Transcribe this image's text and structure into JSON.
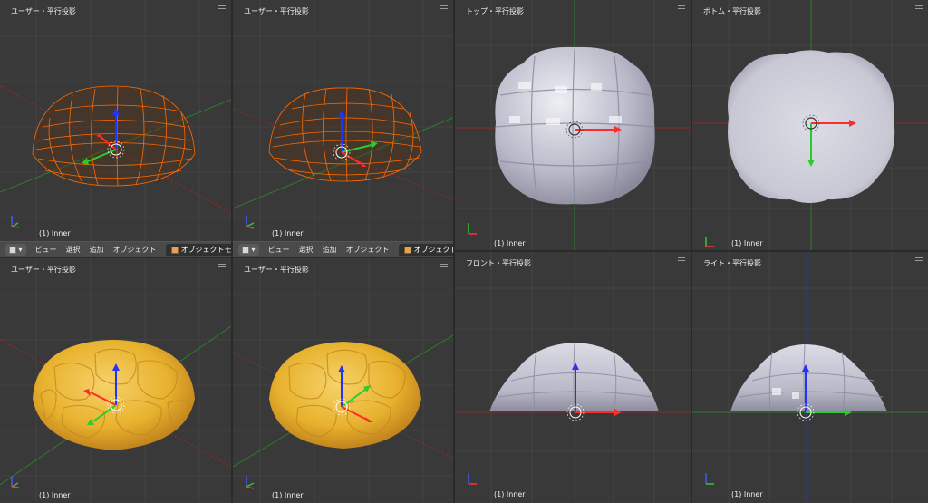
{
  "viewports": [
    {
      "title": "ユーザー・平行投影",
      "object": "(1) Inner",
      "style": "wireframe"
    },
    {
      "title": "ユーザー・平行投影",
      "object": "(1) Inner",
      "style": "wireframe"
    },
    {
      "title": "ユーザー・平行投影",
      "object": "(1) Inner",
      "style": "textured"
    },
    {
      "title": "ユーザー・平行投影",
      "object": "(1) Inner",
      "style": "textured"
    },
    {
      "title": "トップ・平行投影",
      "object": "(1) Inner",
      "style": "solid-top"
    },
    {
      "title": "ボトム・平行投影",
      "object": "(1) Inner",
      "style": "solid-bottom"
    },
    {
      "title": "フロント・平行投影",
      "object": "(1) Inner",
      "style": "solid-front"
    },
    {
      "title": "ライト・平行投影",
      "object": "(1) Inner",
      "style": "solid-side"
    }
  ],
  "header_bars": [
    {
      "view": "ビュー",
      "select": "選択",
      "add": "追加",
      "object": "オブジェクト",
      "mode": "オブジェクトモード"
    },
    {
      "view": "ビュー",
      "select": "選択",
      "add": "追加",
      "object": "オブジェクト",
      "mode": "オブジェクトモード"
    }
  ],
  "colors": {
    "viewport_bg": "#393939",
    "grid": "#444444",
    "x_axis": "#8c2a2a",
    "y_axis": "#2f7a2f",
    "z_axis": "#2a3a8c",
    "wire": "#ff6a00",
    "bread_light": "#f2c24a",
    "bread_dark": "#c98a1a",
    "solid": "#c4c4d0"
  }
}
